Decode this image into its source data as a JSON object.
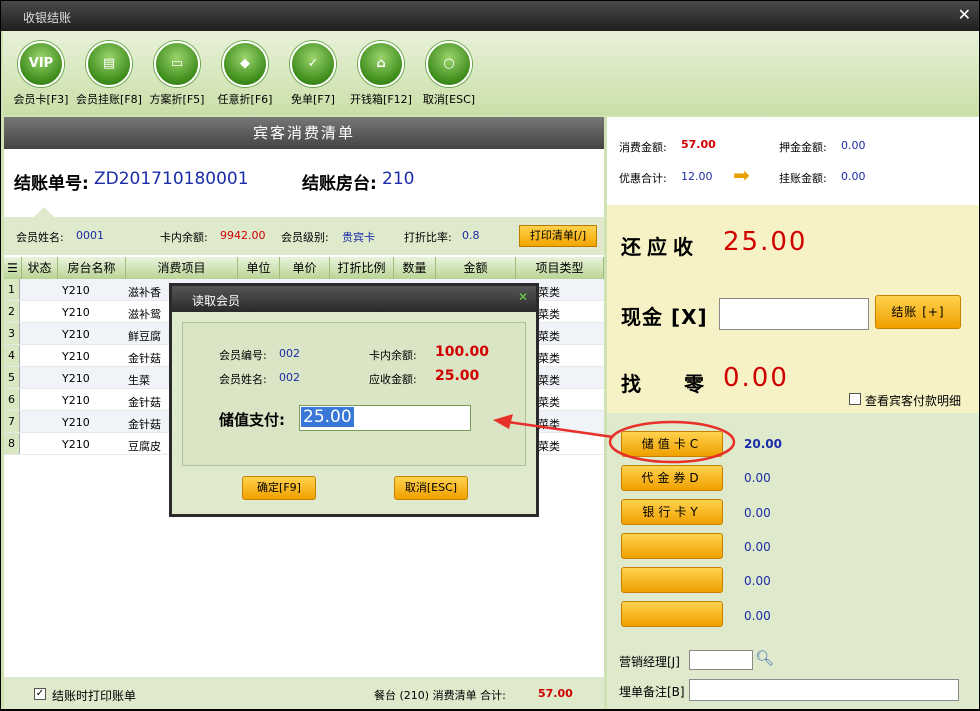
{
  "window": {
    "title": "收银结账",
    "close": "✕"
  },
  "toolbar": [
    {
      "label": "会员卡[F3]",
      "glyph": "VIP"
    },
    {
      "label": "会员挂账[F8]",
      "glyph": "▤"
    },
    {
      "label": "方案折[F5]",
      "glyph": "▭"
    },
    {
      "label": "任意折[F6]",
      "glyph": "◆"
    },
    {
      "label": "免单[F7]",
      "glyph": "✓"
    },
    {
      "label": "开钱箱[F12]",
      "glyph": "⌂"
    },
    {
      "label": "取消[ESC]",
      "glyph": "○"
    }
  ],
  "left": {
    "title": "宾客消费清单",
    "bill_no_label": "结账单号:",
    "bill_no": "ZD201710180001",
    "room_label": "结账房台:",
    "room": "210",
    "member": {
      "name_label": "会员姓名:",
      "name": "0001",
      "balance_label": "卡内余额:",
      "balance": "9942.00",
      "level_label": "会员级别:",
      "level": "贵宾卡",
      "discount_label": "打折比率:",
      "discount": "0.8",
      "print_button": "打印清单[/]"
    },
    "columns": [
      "☰",
      "状态",
      "房台名称",
      "消费项目",
      "单位",
      "单价",
      "打折比例",
      "数量",
      "金额",
      "项目类型"
    ],
    "rows": [
      {
        "n": "1",
        "room": "Y210",
        "item": "滋补香",
        "type": "菜类"
      },
      {
        "n": "2",
        "room": "Y210",
        "item": "滋补鸳",
        "type": "菜类"
      },
      {
        "n": "3",
        "room": "Y210",
        "item": "鲜豆腐",
        "type": "菜类"
      },
      {
        "n": "4",
        "room": "Y210",
        "item": "金针菇",
        "type": "菜类"
      },
      {
        "n": "5",
        "room": "Y210",
        "item": "生菜",
        "type": "菜类"
      },
      {
        "n": "6",
        "room": "Y210",
        "item": "金针菇",
        "type": "菜类"
      },
      {
        "n": "7",
        "room": "Y210",
        "item": "金针菇",
        "type": "菜类"
      },
      {
        "n": "8",
        "room": "Y210",
        "item": "豆腐皮",
        "type": "菜类"
      }
    ],
    "footer": {
      "print_on_checkout": "结账时打印账单",
      "summary": "餐台 (210) 消费清单 合计:",
      "total": "57.00"
    }
  },
  "right": {
    "consume_label": "消费金额:",
    "consume": "57.00",
    "deposit_label": "押金金额:",
    "deposit": "0.00",
    "discount_total_label": "优惠合计:",
    "discount_total": "12.00",
    "credit_label": "挂账金额:",
    "credit": "0.00",
    "due_label": "还应收",
    "due": "25.00",
    "cash_label": "现金 [X]",
    "checkout_button": "结账 [+]",
    "change_label": "找  零",
    "change": "0.00",
    "view_detail": "查看宾客付款明细",
    "payments": [
      {
        "label": "储值卡C",
        "value": "20.00"
      },
      {
        "label": "代金券D",
        "value": "0.00"
      },
      {
        "label": "银行卡Y",
        "value": "0.00"
      },
      {
        "label": "",
        "value": "0.00"
      },
      {
        "label": "",
        "value": "0.00"
      },
      {
        "label": "",
        "value": "0.00"
      }
    ],
    "manager_label": "营销经理[J]",
    "note_label": "埋单备注[B]"
  },
  "dialog": {
    "title": "读取会员",
    "close": "✕",
    "member_no_label": "会员编号:",
    "member_no": "002",
    "balance_label": "卡内余额:",
    "balance": "100.00",
    "member_name_label": "会员姓名:",
    "member_name": "002",
    "due_label": "应收金额:",
    "due": "25.00",
    "store_pay_label": "储值支付:",
    "store_pay": "25.00",
    "ok": "确定[F9]",
    "cancel": "取消[ESC]"
  },
  "colors": {
    "accent": "#f0a000",
    "red": "#d10000",
    "blue": "#1a2ca8",
    "annotation": "#e8302a"
  }
}
